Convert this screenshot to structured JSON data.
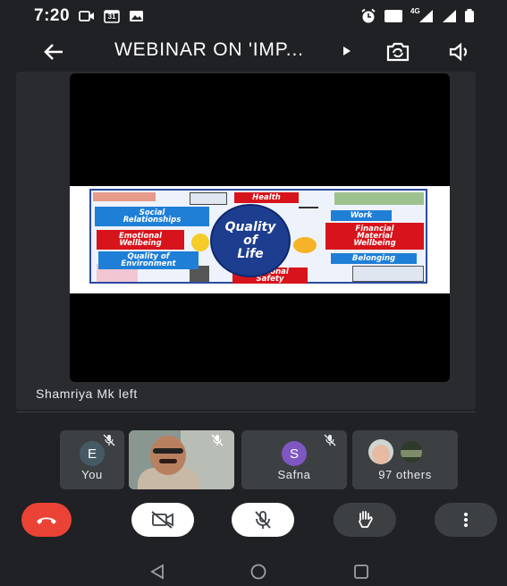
{
  "status_bar": {
    "time": "7:20",
    "calendar_day": "31",
    "network": "4G",
    "volte": "VoLTE"
  },
  "app_bar": {
    "title": "WEBINAR ON 'IMP..."
  },
  "slide": {
    "center_line1": "Quality",
    "center_line2": "of",
    "center_line3": "Life",
    "tags": {
      "health": "Health",
      "social_1": "Social",
      "social_2": "Relationships",
      "work": "Work",
      "emotional_1": "Emotional",
      "emotional_2": "Wellbeing",
      "financial_1": "Financial",
      "financial_2": "Material",
      "financial_3": "Wellbeing",
      "environment_1": "Quality of",
      "environment_2": "Environment",
      "belonging": "Belonging",
      "safety_1": "Personal",
      "safety_2": "Safety"
    }
  },
  "notice": "Shamriya Mk left",
  "participants": [
    {
      "initial": "E",
      "label": "You",
      "avatar_color": "#455a64"
    },
    {
      "initial": "",
      "label": ""
    },
    {
      "initial": "S",
      "label": "Safna",
      "avatar_color": "#7e57c2"
    },
    {
      "initial": "",
      "label": "97 others"
    }
  ],
  "colors": {
    "background": "#202124",
    "tile": "#3c4043",
    "end_call": "#ea4335",
    "control_white": "#ffffff",
    "control_dark": "#3c4043"
  }
}
